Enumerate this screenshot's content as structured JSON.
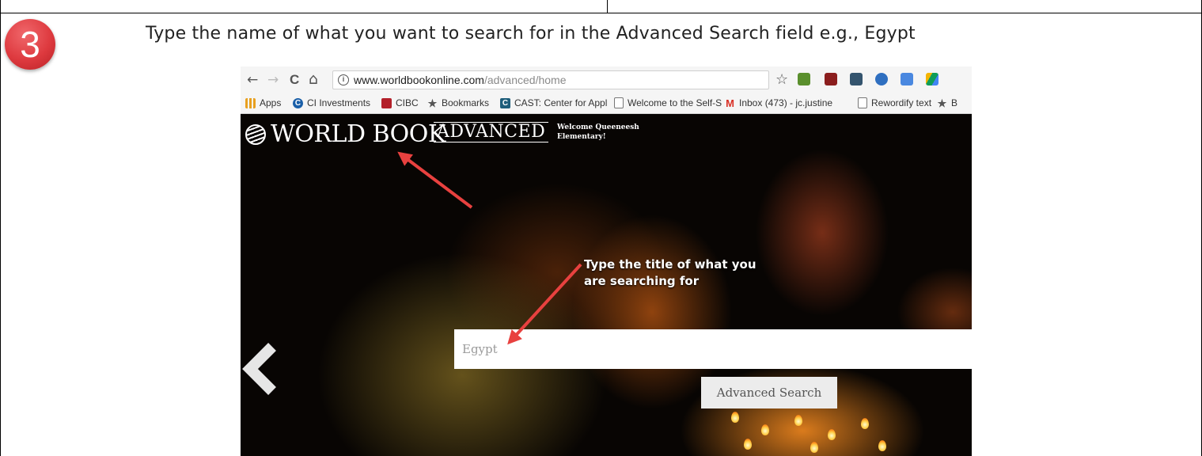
{
  "step": {
    "number": "3"
  },
  "instruction": "Type the name of what you want to search for in the Advanced Search field e.g., Egypt",
  "browser": {
    "nav": {
      "back_icon": "←",
      "forward_icon": "→",
      "reload_icon": "C",
      "home_icon": "⌂"
    },
    "info_icon": "i",
    "url_domain": "www.worldbookonline.com",
    "url_path": "/advanced/home",
    "star_icon": "☆",
    "extensions": [
      "evernote-icon",
      "ublock-icon",
      "pocket-icon",
      "yesware-icon",
      "translate-icon",
      "drive-icon"
    ],
    "bookmarks": [
      {
        "label": "Apps",
        "icon": "apps-icon",
        "color": "#e8a020"
      },
      {
        "label": "CI Investments",
        "icon": "ci-icon",
        "color": "#1a5fa8"
      },
      {
        "label": "CIBC",
        "icon": "cibc-icon",
        "color": "#b3202a"
      },
      {
        "label": "Bookmarks",
        "icon": "star-icon",
        "color": "#555555"
      },
      {
        "label": "CAST: Center for Appl",
        "icon": "cast-icon",
        "color": "#1d5d7a"
      },
      {
        "label": "Welcome to the Self-S",
        "icon": "page-icon",
        "color": "#777777"
      },
      {
        "label": "Inbox (473) - jc.justine",
        "icon": "gmail-icon",
        "color": "#d93025"
      },
      {
        "label": "Rewordify text",
        "icon": "page-icon",
        "color": "#777777"
      },
      {
        "label": "B",
        "icon": "star-icon",
        "color": "#555555"
      }
    ]
  },
  "site": {
    "logo_text": "WORLD BOOK",
    "advanced_label": "ADVANCED",
    "welcome_text": "Welcome Queeneesh Elementary!",
    "search_value": "Egypt",
    "search_button": "Advanced Search",
    "annotation": "Type the title of what you are searching for"
  },
  "colors": {
    "badge": "#de3a3f",
    "arrow": "#e8413f",
    "button_bg": "#ececec"
  }
}
